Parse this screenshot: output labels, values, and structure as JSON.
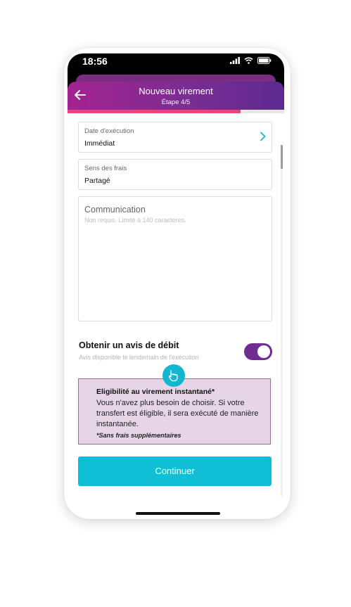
{
  "status_bar": {
    "time": "18:56"
  },
  "header": {
    "title": "Nouveau virement",
    "step": "Étape 4/5"
  },
  "progress": {
    "value": 0.8
  },
  "fields": {
    "execution_date": {
      "label": "Date d'exécution",
      "value": "Immédiat"
    },
    "fees": {
      "label": "Sens des frais",
      "value": "Partagé"
    },
    "communication": {
      "label": "Communication",
      "placeholder": "Non requis. Limité à 140 caractères."
    }
  },
  "debit_notice": {
    "title": "Obtenir un avis de débit",
    "subtitle": "Avis disponible le lendemain de l'exécution",
    "enabled": true
  },
  "instant_info": {
    "title": "Eligibilité au virement instantané*",
    "body": "Vous n'avez plus besoin de choisir. Si votre transfert est éligible, il sera exécuté de manière instantanée.",
    "note": "*Sans frais supplémentaires",
    "icon": "hand-pointer-icon"
  },
  "cta": {
    "label": "Continuer"
  },
  "colors": {
    "brand_purple": "#6f2c91",
    "header_gradient_start": "#a3238f",
    "accent_pink": "#e8457f",
    "cta_cyan": "#10bfd6",
    "info_background": "#e6d5e7"
  }
}
